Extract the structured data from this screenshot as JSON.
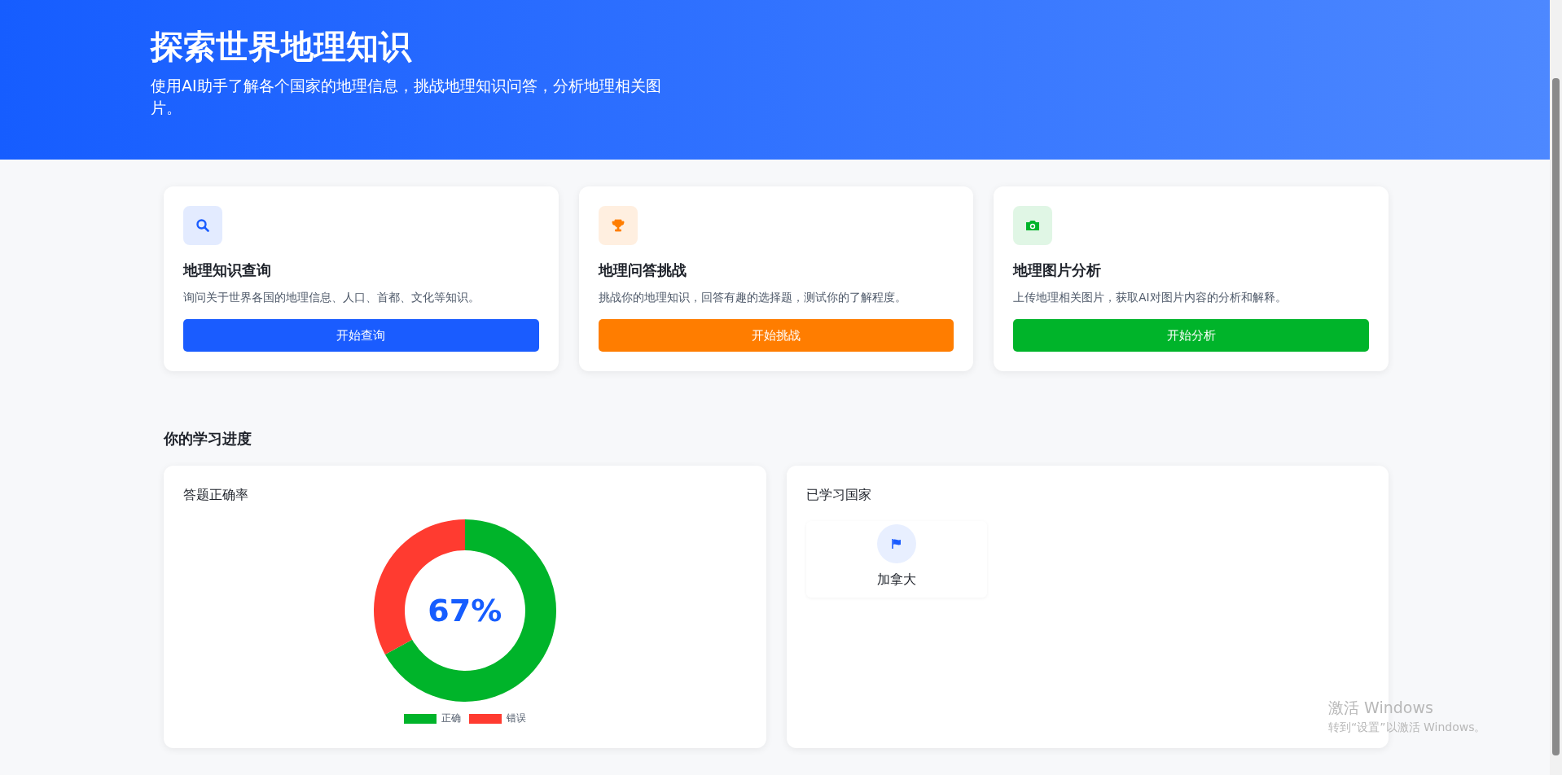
{
  "hero": {
    "title": "探索世界地理知识",
    "subtitle": "使用AI助手了解各个国家的地理信息，挑战地理知识问答，分析地理相关图片。"
  },
  "features": [
    {
      "kind": "search",
      "title": "地理知识查询",
      "description": "询问关于世界各国的地理信息、人口、首都、文化等知识。",
      "button": "开始查询",
      "color": "#1a5cff"
    },
    {
      "kind": "trophy",
      "title": "地理问答挑战",
      "description": "挑战你的地理知识，回答有趣的选择题，测试你的了解程度。",
      "button": "开始挑战",
      "color": "#ff7d00"
    },
    {
      "kind": "camera",
      "title": "地理图片分析",
      "description": "上传地理相关图片，获取AI对图片内容的分析和解释。",
      "button": "开始分析",
      "color": "#00b42a"
    }
  ],
  "progress": {
    "title": "你的学习进度",
    "accuracy": {
      "title": "答题正确率",
      "center_label": "67%",
      "chart_data": {
        "type": "donut",
        "categories": [
          "正确",
          "错误"
        ],
        "values": [
          67,
          33
        ],
        "colors": [
          "#00b42a",
          "#ff3b30"
        ],
        "legend": "bottom"
      }
    },
    "countries": {
      "title": "已学习国家",
      "items": [
        {
          "name": "加拿大"
        }
      ]
    }
  },
  "os_watermark": {
    "title": "激活 Windows",
    "subtitle": "转到“设置”以激活 Windows。"
  }
}
